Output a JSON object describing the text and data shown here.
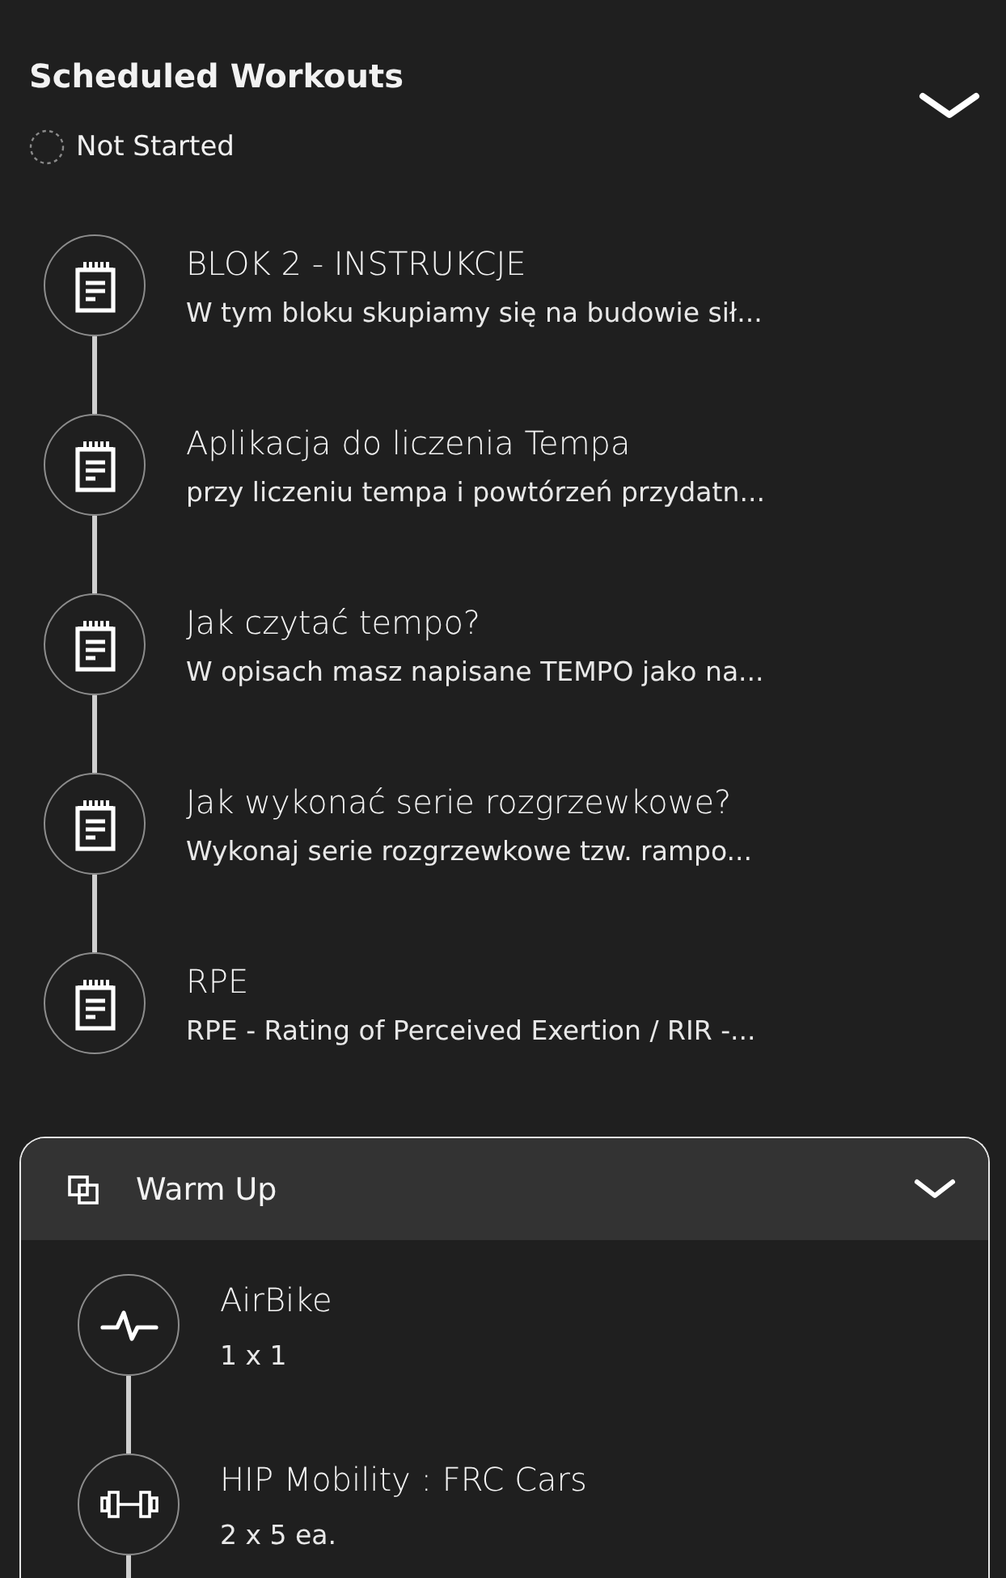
{
  "header": {
    "title": "Scheduled Workouts",
    "status": "Not Started",
    "expanded": true
  },
  "items": [
    {
      "title": "BLOK 2 - INSTRUKCJE",
      "subtitle": "W tym bloku skupiamy się na budowie sił..."
    },
    {
      "title": "Aplikacja do liczenia Tempa",
      "subtitle": "przy liczeniu tempa i powtórzeń przydatn..."
    },
    {
      "title": "Jak czytać tempo?",
      "subtitle": "W opisach masz napisane TEMPO jako na..."
    },
    {
      "title": "Jak wykonać serie rozgrzewkowe?",
      "subtitle": "Wykonaj serie rozgrzewkowe tzw. rampo..."
    },
    {
      "title": "RPE",
      "subtitle": "RPE - Rating of Perceived Exertion / RIR -..."
    }
  ],
  "sections": [
    {
      "title": "Warm Up",
      "expanded": true,
      "exercises": [
        {
          "kind": "cardio",
          "title": "AirBike",
          "detail": "1 x 1"
        },
        {
          "kind": "weights",
          "title": "HIP Mobility : FRC Cars",
          "detail": "2 x 5 ea."
        }
      ]
    }
  ]
}
